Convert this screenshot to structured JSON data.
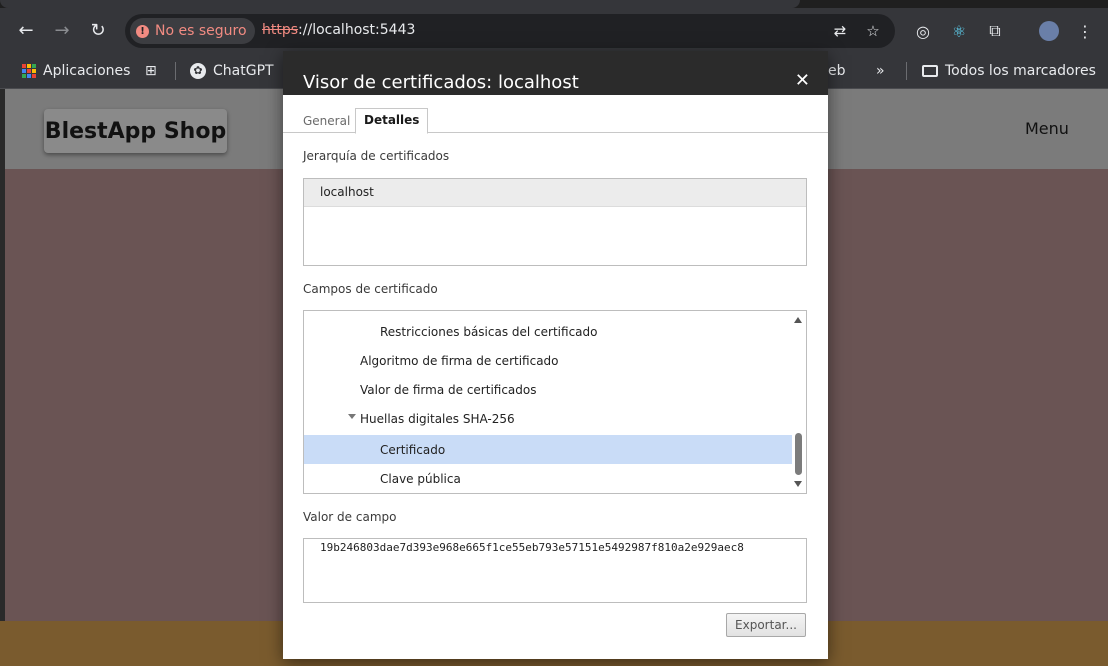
{
  "browser": {
    "security_label": "No es seguro",
    "url_protocol": "https",
    "url_rest": "://localhost:5443"
  },
  "bookmarks": {
    "apps_label": "Aplicaciones",
    "chatgpt_label": "ChatGPT",
    "partial_label": "eb",
    "overflow_label": "»",
    "all_bookmarks_label": "Todos los marcadores"
  },
  "page": {
    "logo_text": "BlestApp Shop",
    "menu_label": "Menu"
  },
  "dialog": {
    "title": "Visor de certificados: localhost",
    "close_glyph": "✕",
    "tabs": [
      {
        "label": "General"
      },
      {
        "label": "Detalles"
      }
    ],
    "hierarchy_label": "Jerarquía de certificados",
    "hierarchy_items": [
      "localhost"
    ],
    "fields_label": "Campos de certificado",
    "fields": [
      {
        "label": "Restricciones básicas del certificado"
      },
      {
        "label": "Algoritmo de firma de certificado"
      },
      {
        "label": "Valor de firma de certificados"
      },
      {
        "label": "Huellas digitales SHA-256"
      },
      {
        "label": "Certificado"
      },
      {
        "label": "Clave pública"
      }
    ],
    "value_label": "Valor de campo",
    "field_value": "19b246803dae7d393e968e665f1ce55eb793e57151e5492987f810a2e929aec8",
    "export_label": "Exportar..."
  },
  "colors": {
    "selection": "#c9dcf7",
    "warning": "#f28b82",
    "titlebar": "#2b2b2b"
  },
  "icons": [
    "back-arrow-icon",
    "forward-arrow-icon",
    "reload-icon",
    "warning-icon",
    "translate-icon",
    "star-icon",
    "extension-icon",
    "react-icon",
    "puzzle-icon",
    "avatar",
    "more-vert-icon",
    "apps-grid-icon",
    "chatgpt-icon",
    "folder-icon",
    "close-icon",
    "scroll-up-icon",
    "scroll-down-icon",
    "expand-triangle-icon"
  ]
}
